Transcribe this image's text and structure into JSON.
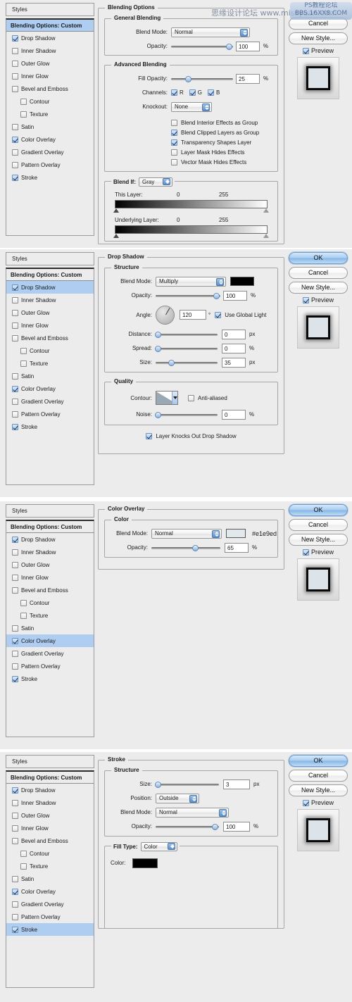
{
  "watermark": {
    "text": "思缘设计论坛  www.missyuan.com",
    "logo_line1": "PS教程论坛",
    "logo_line2": "BBS.16XX8.COM"
  },
  "sidebar": {
    "header": "Styles",
    "blending_options": "Blending Options: Custom",
    "items": [
      {
        "label": "Drop Shadow",
        "checked": true,
        "sub": false
      },
      {
        "label": "Inner Shadow",
        "checked": false,
        "sub": false
      },
      {
        "label": "Outer Glow",
        "checked": false,
        "sub": false
      },
      {
        "label": "Inner Glow",
        "checked": false,
        "sub": false
      },
      {
        "label": "Bevel and Emboss",
        "checked": false,
        "sub": false
      },
      {
        "label": "Contour",
        "checked": false,
        "sub": true
      },
      {
        "label": "Texture",
        "checked": false,
        "sub": true
      },
      {
        "label": "Satin",
        "checked": false,
        "sub": false
      },
      {
        "label": "Color Overlay",
        "checked": true,
        "sub": false
      },
      {
        "label": "Gradient Overlay",
        "checked": false,
        "sub": false
      },
      {
        "label": "Pattern Overlay",
        "checked": false,
        "sub": false
      },
      {
        "label": "Stroke",
        "checked": true,
        "sub": false
      }
    ]
  },
  "buttons": {
    "ok": "OK",
    "cancel": "Cancel",
    "new_style": "New Style...",
    "preview": "Preview"
  },
  "panels": [
    {
      "id": "blending-options",
      "selected_style": "Blending Options: Custom",
      "title": "Blending Options",
      "ok_hidden_by_watermark": true,
      "groups": {
        "general": {
          "title": "General Blending",
          "blend_mode_label": "Blend Mode:",
          "blend_mode_value": "Normal",
          "opacity_label": "Opacity:",
          "opacity_value": "100",
          "opacity_unit": "%",
          "opacity_pct": 100
        },
        "advanced": {
          "title": "Advanced Blending",
          "fill_opacity_label": "Fill Opacity:",
          "fill_opacity_value": "25",
          "fill_opacity_unit": "%",
          "fill_opacity_pct": 25,
          "channels_label": "Channels:",
          "channels": [
            {
              "label": "R",
              "checked": true
            },
            {
              "label": "G",
              "checked": true
            },
            {
              "label": "B",
              "checked": true
            }
          ],
          "knockout_label": "Knockout:",
          "knockout_value": "None",
          "options": [
            {
              "label": "Blend Interior Effects as Group",
              "checked": false
            },
            {
              "label": "Blend Clipped Layers as Group",
              "checked": true
            },
            {
              "label": "Transparency Shapes Layer",
              "checked": true
            },
            {
              "label": "Layer Mask Hides Effects",
              "checked": false
            },
            {
              "label": "Vector Mask Hides Effects",
              "checked": false
            }
          ]
        },
        "blend_if": {
          "label": "Blend If:",
          "value": "Gray",
          "this_layer_label": "This Layer:",
          "this_layer_min": "0",
          "this_layer_max": "255",
          "underlying_label": "Underlying Layer:",
          "underlying_min": "0",
          "underlying_max": "255"
        }
      }
    },
    {
      "id": "drop-shadow",
      "selected_style": "Drop Shadow",
      "title": "Drop Shadow",
      "ok_hidden_by_watermark": false,
      "groups": {
        "structure": {
          "title": "Structure",
          "blend_mode_label": "Blend Mode:",
          "blend_mode_value": "Multiply",
          "blend_color": "#000000",
          "opacity_label": "Opacity:",
          "opacity_value": "100",
          "opacity_unit": "%",
          "opacity_pct": 100,
          "angle_label": "Angle:",
          "angle_value": "120",
          "angle_unit": "°",
          "use_global_light_label": "Use Global Light",
          "use_global_light": true,
          "distance_label": "Distance:",
          "distance_value": "0",
          "distance_unit": "px",
          "distance_pct": 0,
          "spread_label": "Spread:",
          "spread_value": "0",
          "spread_unit": "%",
          "spread_pct": 0,
          "size_label": "Size:",
          "size_value": "35",
          "size_unit": "px",
          "size_pct": 24
        },
        "quality": {
          "title": "Quality",
          "contour_label": "Contour:",
          "anti_aliased_label": "Anti-aliased",
          "anti_aliased": false,
          "noise_label": "Noise:",
          "noise_value": "0",
          "noise_unit": "%",
          "noise_pct": 0
        },
        "knocks_out_label": "Layer Knocks Out Drop Shadow",
        "knocks_out": true
      }
    },
    {
      "id": "color-overlay",
      "selected_style": "Color Overlay",
      "title": "Color Overlay",
      "ok_hidden_by_watermark": false,
      "groups": {
        "color": {
          "title": "Color",
          "blend_mode_label": "Blend Mode:",
          "blend_mode_value": "Normal",
          "color_hex": "#e1e9ed",
          "color_hex_text": "#e1e9ed",
          "opacity_label": "Opacity:",
          "opacity_value": "65",
          "opacity_unit": "%",
          "opacity_pct": 65
        }
      }
    },
    {
      "id": "stroke",
      "selected_style": "Stroke",
      "title": "Stroke",
      "ok_hidden_by_watermark": false,
      "groups": {
        "structure": {
          "title": "Structure",
          "size_label": "Size:",
          "size_value": "3",
          "size_unit": "px",
          "size_pct": 2,
          "position_label": "Position:",
          "position_value": "Outside",
          "blend_mode_label": "Blend Mode:",
          "blend_mode_value": "Normal",
          "opacity_label": "Opacity:",
          "opacity_value": "100",
          "opacity_unit": "%",
          "opacity_pct": 100
        },
        "fill": {
          "fill_type_label": "Fill Type:",
          "fill_type_value": "Color",
          "color_label": "Color:",
          "color_hex": "#000000"
        }
      }
    }
  ]
}
